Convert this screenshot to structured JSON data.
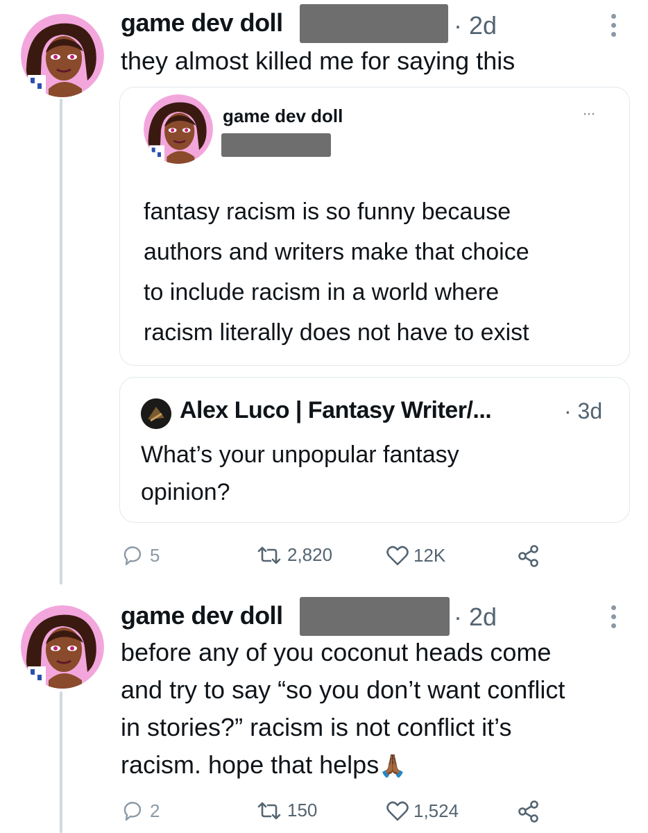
{
  "tweet1": {
    "author": "game dev doll",
    "time": "· 2d",
    "text": "they almost killed me for saying this",
    "quote": {
      "author": "game dev doll",
      "lines": [
        "fantasy racism is so funny because",
        "authors and writers make that choice",
        "to include racism in a world where",
        "racism literally does not have to exist"
      ]
    },
    "quote2": {
      "author": "Alex Luco | Fantasy Writer/...",
      "time": "· 3d",
      "lines": [
        "What’s your unpopular fantasy",
        "opinion?"
      ]
    },
    "metrics": {
      "replies": "5",
      "retweets": "2,820",
      "likes": "12K"
    }
  },
  "tweet2": {
    "author": "game dev doll",
    "time": "· 2d",
    "lines": [
      "before any of you coconut heads come",
      "and try to say “so you don’t want conflict",
      "in stories?” racism is not conflict it’s",
      "racism. hope that helps"
    ],
    "emoji": "🙏🏾",
    "metrics": {
      "replies": "2",
      "retweets": "150",
      "likes": "1,524"
    }
  },
  "colors": {
    "text": "#0f1419",
    "muted": "#536471",
    "thread": "#cfd9de",
    "avatar_bg": "#f3a6dc"
  },
  "icons": [
    "avatar",
    "more-icon",
    "reply-icon",
    "retweet-icon",
    "like-icon",
    "share-icon"
  ]
}
